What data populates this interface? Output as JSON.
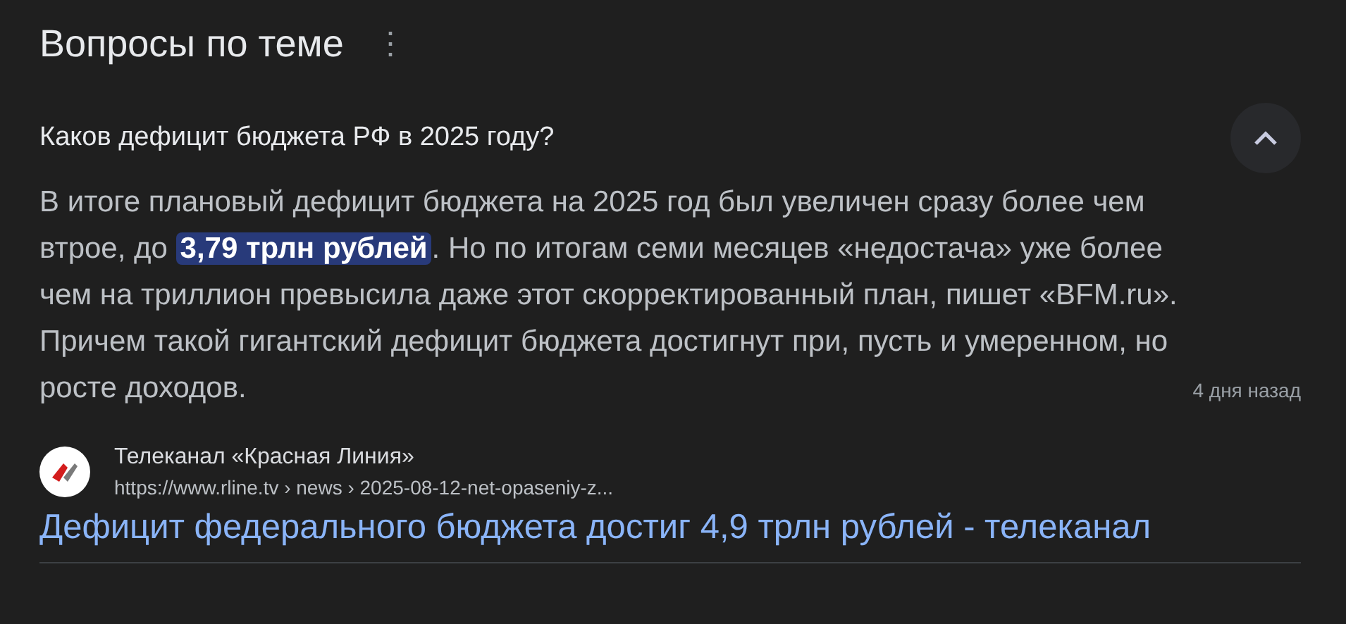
{
  "section": {
    "title": "Вопросы по теме",
    "menu_icon": "⋮"
  },
  "question": {
    "text": "Каков дефицит бюджета РФ в 2025 году?",
    "expanded": true
  },
  "answer": {
    "text": "В итоге плановый дефицит бюджета на 2025 год был увеличен сразу более чем втрое, до **3,79 трлн рублей**. Но по итогам семи месяцев «недостача» уже более чем на триллион превысила даже этот скорректированный план, пишет «BFM.ru». Причем такой гигантский дефицит бюджета достигнут при, пусть и умеренном, но росте доходов.",
    "time": "4 дня назад"
  },
  "source": {
    "site": "Телеканал «Красная Линия»",
    "url": "https://www.rline.tv › news › 2025-08-12-net-opaseniy-z...",
    "title": "Дефицит федерального бюджета достиг 4,9 трлн рублей - телеканал"
  }
}
